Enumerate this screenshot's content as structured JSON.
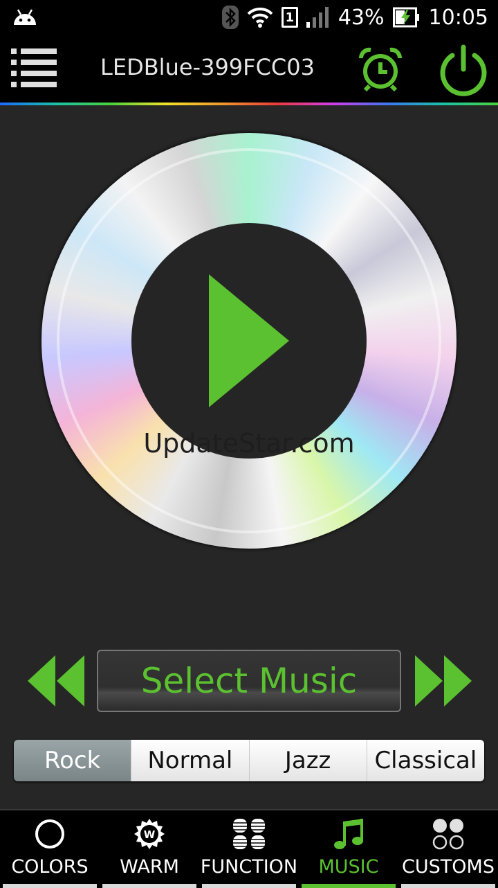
{
  "status_bar": {
    "battery": "43%",
    "time": "10:05",
    "sim_slot": "1",
    "icons": [
      "android-icon",
      "bluetooth-icon",
      "wifi-icon",
      "sim-icon",
      "signal-icon",
      "battery-charging-icon"
    ]
  },
  "header": {
    "title": "LEDBlue-399FCC03",
    "icons": [
      "menu-icon",
      "alarm-clock-icon",
      "power-icon"
    ]
  },
  "player": {
    "watermark": "UpdateStar.com",
    "select_label": "Select Music",
    "icons": [
      "play-icon",
      "rewind-icon",
      "fast-forward-icon"
    ]
  },
  "genres": [
    {
      "label": "Rock",
      "active": true
    },
    {
      "label": "Normal",
      "active": false
    },
    {
      "label": "Jazz",
      "active": false
    },
    {
      "label": "Classical",
      "active": false
    }
  ],
  "nav": [
    {
      "label": "COLORS",
      "icon": "circle-icon",
      "active": false
    },
    {
      "label": "WARM",
      "icon": "warm-badge-icon",
      "active": false
    },
    {
      "label": "FUNCTION",
      "icon": "grid-icon",
      "active": false
    },
    {
      "label": "MUSIC",
      "icon": "music-note-icon",
      "active": true
    },
    {
      "label": "CUSTOMS",
      "icon": "dots-icon",
      "active": false
    }
  ],
  "colors": {
    "accent": "#5bc130",
    "background": "#262626",
    "bar": "#000000"
  }
}
